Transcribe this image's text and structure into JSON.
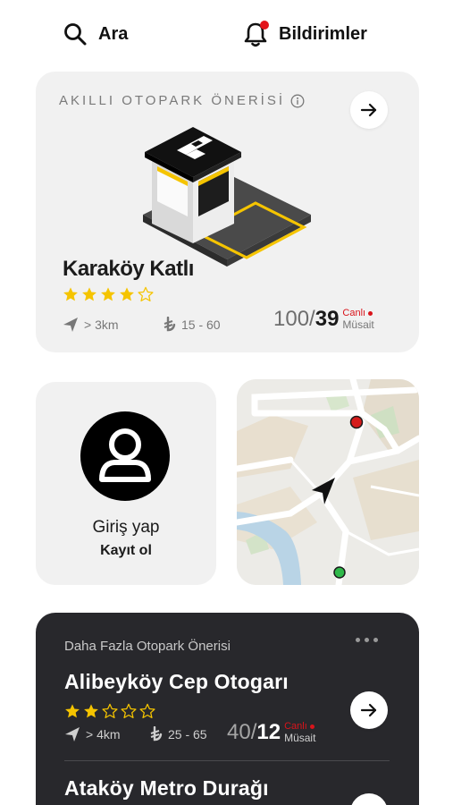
{
  "header": {
    "search_label": "Ara",
    "notifications_label": "Bildirimler"
  },
  "smart_suggestion": {
    "title": "AKILLI OTOPARK ÖNERİSİ",
    "name": "Karaköy Katlı",
    "rating": 4,
    "rating_max": 5,
    "distance": "> 3km",
    "price": "15 - 60",
    "capacity_total": "100",
    "capacity_available": "39",
    "live_label": "Canlı",
    "available_label": "Müsait"
  },
  "login": {
    "signin_label": "Giriş yap",
    "signup_label": "Kayıt ol"
  },
  "more_suggestions": {
    "title": "Daha Fazla Otopark Önerisi",
    "items": [
      {
        "name": "Alibeyköy Cep Otogarı",
        "rating": 2,
        "rating_max": 5,
        "distance": "> 4km",
        "price": "25 - 65",
        "capacity_total": "40",
        "capacity_available": "12",
        "live_label": "Canlı",
        "available_label": "Müsait"
      },
      {
        "name": "Ataköy Metro Durağı"
      }
    ]
  },
  "colors": {
    "accent_yellow": "#f5c400",
    "live_red": "#d9141b",
    "dark_card": "#28282c",
    "light_card": "#f1f1f1"
  },
  "icons": {
    "search": "search-icon",
    "notifications": "bell-icon",
    "info": "info-icon",
    "arrow": "arrow-right-icon",
    "navigation": "navigation-arrow-icon",
    "currency": "lira-icon",
    "avatar": "user-avatar-icon"
  }
}
